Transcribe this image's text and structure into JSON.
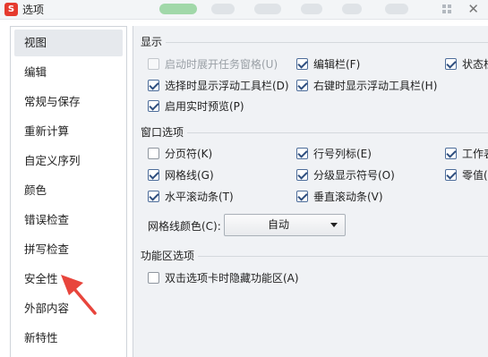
{
  "window": {
    "title": "选项",
    "app_icon_glyph": "S",
    "close_glyph": "✕"
  },
  "sidebar": {
    "items": [
      {
        "label": "视图",
        "selected": true
      },
      {
        "label": "编辑"
      },
      {
        "label": "常规与保存"
      },
      {
        "label": "重新计算"
      },
      {
        "label": "自定义序列"
      },
      {
        "label": "颜色"
      },
      {
        "label": "错误检查"
      },
      {
        "label": "拼写检查"
      },
      {
        "label": "安全性"
      },
      {
        "label": "外部内容"
      },
      {
        "label": "新特性"
      }
    ]
  },
  "display": {
    "title": "显示",
    "options": [
      {
        "label": "启动时展开任务窗格(U)",
        "checked": false,
        "disabled": true
      },
      {
        "label": "编辑栏(F)",
        "checked": true
      },
      {
        "label": "状态栏",
        "checked": true
      },
      {
        "label": "选择时显示浮动工具栏(D)",
        "checked": true
      },
      {
        "label": "右键时显示浮动工具栏(H)",
        "checked": true
      },
      {
        "label": "启用实时预览(P)",
        "checked": true
      }
    ]
  },
  "window_options": {
    "title": "窗口选项",
    "options": [
      {
        "label": "分页符(K)",
        "checked": false
      },
      {
        "label": "行号列标(E)",
        "checked": true
      },
      {
        "label": "工作表",
        "checked": true
      },
      {
        "label": "网格线(G)",
        "checked": true
      },
      {
        "label": "分级显示符号(O)",
        "checked": true
      },
      {
        "label": "零值(Z",
        "checked": true
      },
      {
        "label": "水平滚动条(T)",
        "checked": true
      },
      {
        "label": "垂直滚动条(V)",
        "checked": true
      }
    ],
    "gridline_color_label": "网格线颜色(C):",
    "gridline_color_value": "自动"
  },
  "ribbon_options": {
    "title": "功能区选项",
    "options": [
      {
        "label": "双击选项卡时隐藏功能区(A)",
        "checked": false
      }
    ]
  },
  "colors": {
    "annotation_arrow": "#e8453c",
    "accent": "#2f4f7f"
  }
}
